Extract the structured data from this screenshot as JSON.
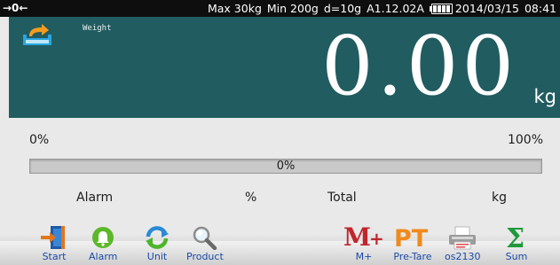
{
  "status_bar": {
    "zero_indicator": "→0←",
    "max": "Max 30kg",
    "min": "Min 200g",
    "division": "d=10g",
    "version": "A1.12.02A",
    "date": "2014/03/15",
    "time": "08:41",
    "battery_level": 1.0
  },
  "display": {
    "label": "Weight",
    "value": "0.00",
    "unit": "kg"
  },
  "progress": {
    "min_label": "0%",
    "max_label": "100%",
    "value_label": "0%",
    "fraction": 0.0
  },
  "info_row": {
    "alarm_label": "Alarm",
    "alarm_unit": "%",
    "total_label": "Total",
    "total_unit": "kg"
  },
  "toolbar": {
    "start": "Start",
    "alarm": "Alarm",
    "unit": "Unit",
    "product": "Product",
    "m_plus": "M+",
    "pre_tare": "Pre-Tare",
    "printer": "os2130",
    "sum": "Sum"
  },
  "icons": {
    "tare": "tare-arrow-icon",
    "start": "door-exit-icon",
    "alarm": "bell-icon",
    "unit": "cycle-arrows-icon",
    "product": "magnifier-icon",
    "m_plus": "m-plus-icon",
    "pre_tare": "pt-icon",
    "printer": "printer-icon",
    "sum": "sigma-icon"
  },
  "colors": {
    "panel": "#215c60",
    "status_bar": "#0e0e0e",
    "toolbar_label": "#1a4aa6",
    "m_plus": "#c0262d",
    "pre_tare": "#f08a1c",
    "sum": "#1f9a3a"
  }
}
